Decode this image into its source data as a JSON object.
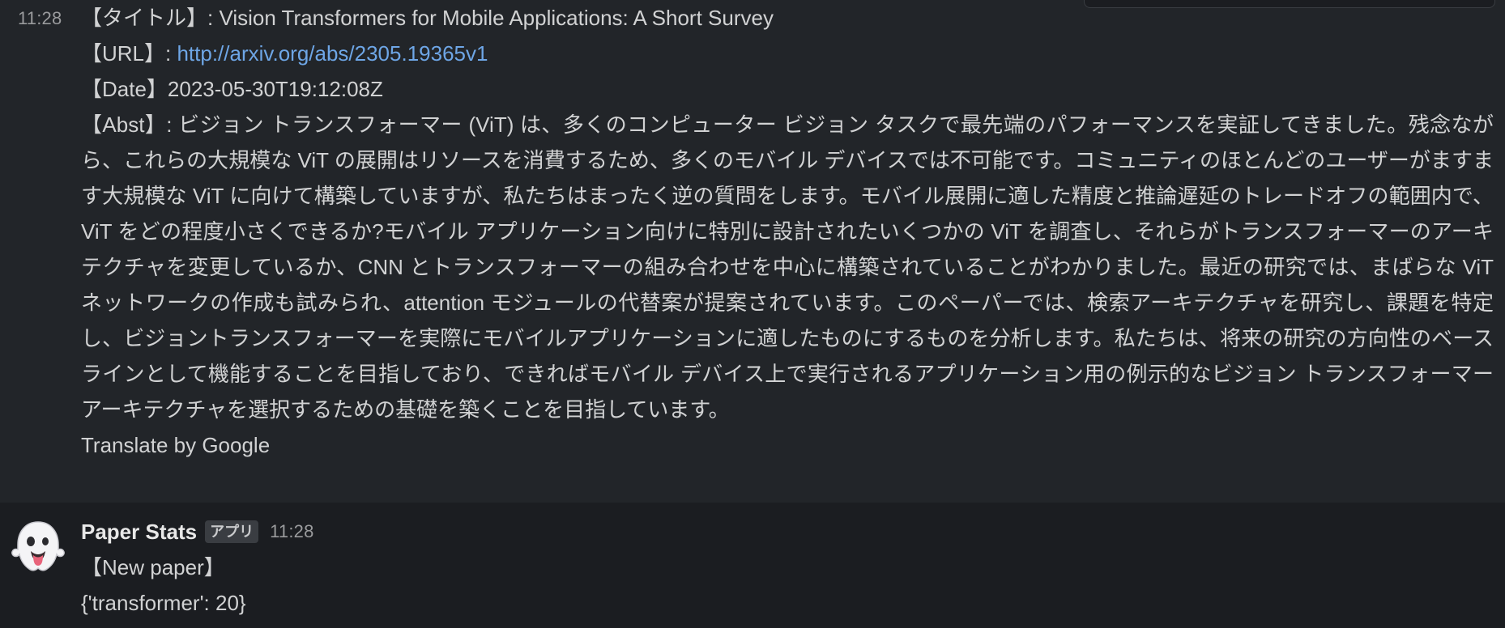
{
  "message1": {
    "time": "11:28",
    "title_line": "【タイトル】: Vision Transformers for Mobile Applications: A Short Survey",
    "url_prefix": "【URL】: ",
    "url": "http://arxiv.org/abs/2305.19365v1",
    "date_line": "【Date】2023-05-30T19:12:08Z",
    "abst": "【Abst】: ビジョン トランスフォーマー (ViT) は、多くのコンピューター ビジョン タスクで最先端のパフォーマンスを実証してきました。残念ながら、これらの大規模な ViT の展開はリソースを消費するため、多くのモバイル デバイスでは不可能です。コミュニティのほとんどのユーザーがますます大規模な ViT に向けて構築していますが、私たちはまったく逆の質問をします。モバイル展開に適した精度と推論遅延のトレードオフの範囲内で、ViT をどの程度小さくできるか?モバイル アプリケーション向けに特別に設計されたいくつかの ViT を調査し、それらがトランスフォーマーのアーキテクチャを変更しているか、CNN とトランスフォーマーの組み合わせを中心に構築されていることがわかりました。最近の研究では、まばらな ViT ネットワークの作成も試みられ、attention モジュールの代替案が提案されています。このペーパーでは、検索アーキテクチャを研究し、課題を特定し、ビジョントランスフォーマーを実際にモバイルアプリケーションに適したものにするものを分析します。私たちは、将来の研究の方向性のベースラインとして機能することを目指しており、できればモバイル デバイス上で実行されるアプリケーション用の例示的なビジョン トランスフォーマー アーキテクチャを選択するための基礎を築くことを目指しています。",
    "translate_label": "Translate by Google"
  },
  "message2": {
    "avatar_icon": "ghost-emoji",
    "avatar_glyph": "👻",
    "sender": "Paper Stats",
    "badge": "アプリ",
    "time": "11:28",
    "line1": "【New paper】",
    "line2": "{'transformer': 20}"
  },
  "colors": {
    "background": "#1b1d21",
    "highlight_background": "#222529",
    "text": "#d1d2d3",
    "link": "#6ea6e6",
    "muted": "#9a9b9d"
  }
}
